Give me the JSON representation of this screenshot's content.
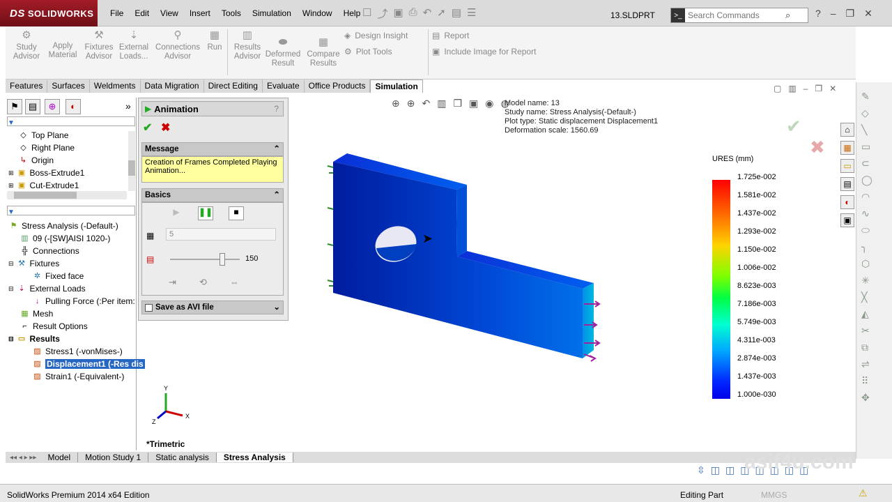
{
  "app": {
    "logo": "SOLIDWORKS",
    "logo_prefix": "DS",
    "document_title": "13.SLDPRT",
    "search_placeholder": "Search Commands"
  },
  "menu": [
    "File",
    "Edit",
    "View",
    "Insert",
    "Tools",
    "Simulation",
    "Window",
    "Help"
  ],
  "ribbon": {
    "study_advisor": "Study Advisor",
    "apply_material": "Apply Material",
    "fixtures_advisor": "Fixtures Advisor",
    "external_loads": "External Loads...",
    "connections_advisor": "Connections Advisor",
    "run": "Run",
    "results_advisor": "Results Advisor",
    "deformed_result": "Deformed Result",
    "compare_results": "Compare Results",
    "design_insight": "Design Insight",
    "plot_tools": "Plot Tools",
    "report": "Report",
    "include_image": "Include Image for Report"
  },
  "command_tabs": [
    "Features",
    "Surfaces",
    "Weldments",
    "Data Migration",
    "Direct Editing",
    "Evaluate",
    "Office Products",
    "Simulation"
  ],
  "feature_tree": {
    "top": [
      "Top Plane",
      "Right Plane",
      "Origin",
      "Boss-Extrude1",
      "Cut-Extrude1"
    ],
    "study": "Stress Analysis (-Default-)",
    "material": "09 (-[SW]AISI 1020-)",
    "connections": "Connections",
    "fixtures": "Fixtures",
    "fixed_face": "Fixed face",
    "external_loads": "External Loads",
    "pulling_force": "Pulling Force (:Per item:",
    "mesh": "Mesh",
    "result_options": "Result Options",
    "results": "Results",
    "stress": "Stress1 (-vonMises-)",
    "displacement": "Displacement1 (-Res dis",
    "strain": "Strain1 (-Equivalent-)"
  },
  "animation": {
    "title": "Animation",
    "message_header": "Message",
    "message": "Creation of Frames Completed Playing Animation...",
    "basics_header": "Basics",
    "frames": "5",
    "speed": "150",
    "speed_fraction": 0.75,
    "avi_label": "Save as AVI file"
  },
  "plot_info": {
    "model_name": "Model name: 13",
    "study_name": "Study name: Stress Analysis(-Default-)",
    "plot_type": "Plot type: Static displacement Displacement1",
    "deformation_scale": "Deformation scale: 1560.69"
  },
  "legend": {
    "title": "URES (mm)",
    "values": [
      "1.725e-002",
      "1.581e-002",
      "1.437e-002",
      "1.293e-002",
      "1.150e-002",
      "1.006e-002",
      "8.623e-003",
      "7.186e-003",
      "5.749e-003",
      "4.311e-003",
      "2.874e-003",
      "1.437e-003",
      "1.000e-030"
    ]
  },
  "view": {
    "orientation": "*Trimetric",
    "triad_x": "X",
    "triad_y": "Y",
    "triad_z": "Z"
  },
  "bottom_tabs": [
    "Model",
    "Motion Study 1",
    "Static analysis",
    "Stress Analysis"
  ],
  "status": {
    "edition": "SolidWorks Premium 2014 x64 Edition",
    "mode": "Editing Part",
    "units": "MMGS",
    "watermark": "asif4u.com"
  }
}
